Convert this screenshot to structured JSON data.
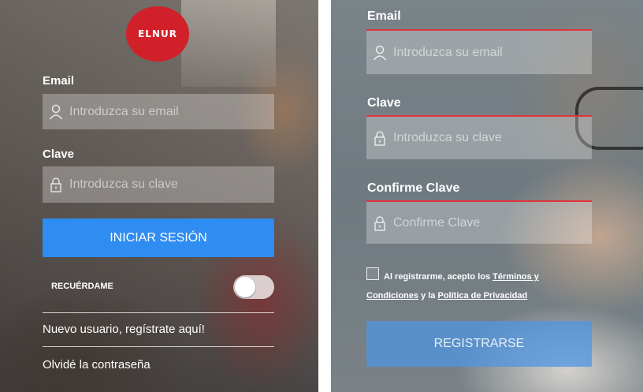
{
  "login": {
    "logo_text": "ELNUR",
    "email_label": "Email",
    "email_placeholder": "Introduzca su email",
    "password_label": "Clave",
    "password_placeholder": "Introduzca su clave",
    "login_button": "INICIAR SESIÓN",
    "remember_label": "RECUÉRDAME",
    "new_user_link": "Nuevo usuario, regístrate aquí!",
    "forgot_link": "Olvidé la contraseña"
  },
  "register": {
    "email_label": "Email",
    "email_placeholder": "Introduzca su email",
    "password_label": "Clave",
    "password_placeholder": "Introduzca su clave",
    "confirm_label": "Confirme Clave",
    "confirm_placeholder": "Confirme Clave",
    "terms_prefix": "Al registrarme, acepto los",
    "terms_link": "Términos y Condiciones",
    "terms_mid": "y la",
    "privacy_link": "Política de Privacidad",
    "register_button": "REGISTRARSE"
  },
  "colors": {
    "accent_blue": "#2f8cf0",
    "error_red": "#e0343c",
    "logo_red": "#d1202a"
  }
}
